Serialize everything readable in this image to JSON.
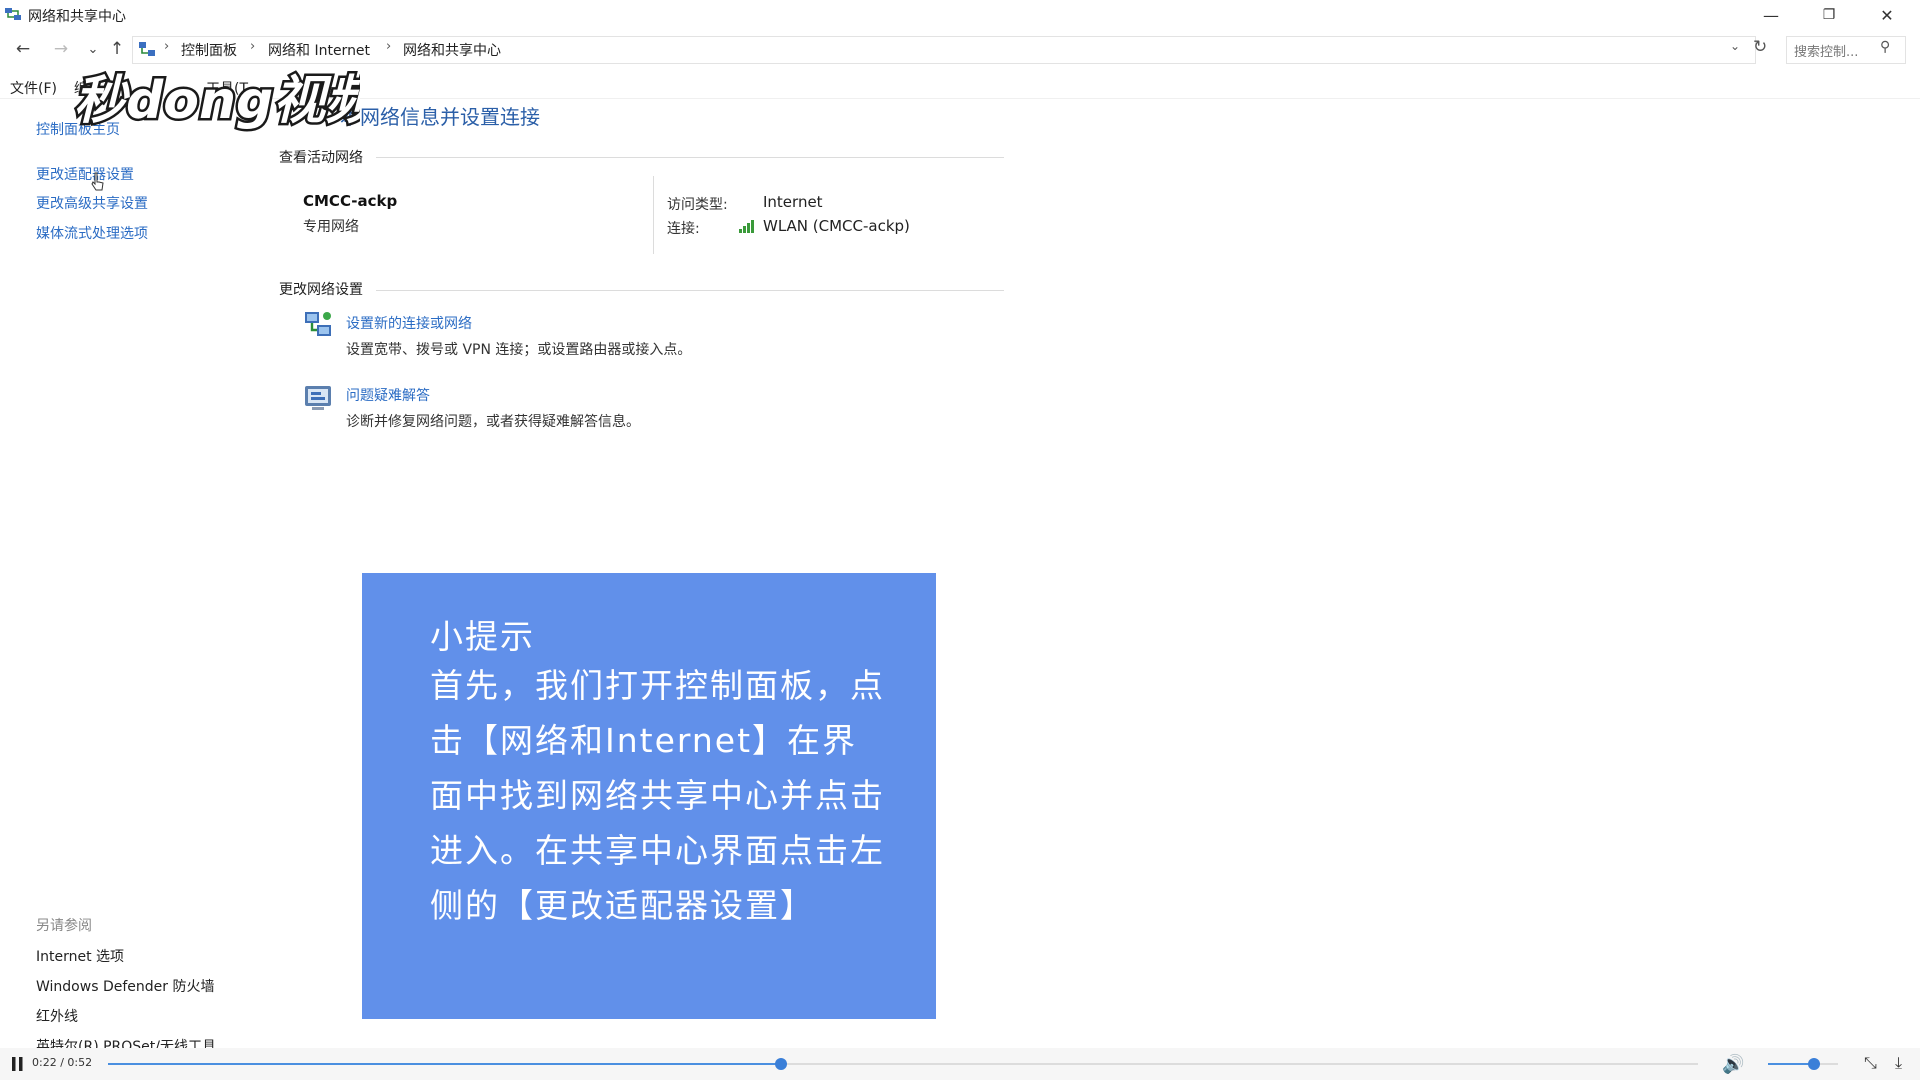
{
  "window": {
    "title": "网络和共享中心",
    "minimize": "—",
    "restore": "❐",
    "close": "✕"
  },
  "address_bar": {
    "back": "←",
    "forward": "→",
    "history": "⌄",
    "up": "↑",
    "breadcrumb": [
      "控制面板",
      "网络和 Internet",
      "网络和共享中心"
    ],
    "separator": "›",
    "dropdown": "⌄",
    "refresh": "↻",
    "search_placeholder": "搜索控制...",
    "search_icon": "⚲"
  },
  "menu": {
    "file": "文件(F)",
    "edit": "编",
    "tools": "工具(T"
  },
  "watermark": {
    "text": "秒dong视频"
  },
  "sidebar": {
    "home": "控制面板主页",
    "items": [
      "更改适配器设置",
      "更改高级共享设置",
      "媒体流式处理选项"
    ],
    "see_also_title": "另请参阅",
    "see_also": [
      "Internet 选项",
      "Windows Defender 防火墙",
      "红外线",
      "英特尔(R) PROSet/无线工具"
    ]
  },
  "main": {
    "title": "本网络信息并设置连接",
    "active_network_heading": "查看活动网络",
    "network_name": "CMCC-ackp",
    "network_type": "专用网络",
    "access_type_label": "访问类型:",
    "access_type_value": "Internet",
    "connection_label": "连接:",
    "connection_value": "WLAN (CMCC-ackp)",
    "change_settings_heading": "更改网络设置",
    "tasks": [
      {
        "link": "设置新的连接或网络",
        "desc": "设置宽带、拨号或 VPN 连接；或设置路由器或接入点。"
      },
      {
        "link": "问题疑难解答",
        "desc": "诊断并修复网络问题，或者获得疑难解答信息。"
      }
    ]
  },
  "tip": {
    "title": "小提示",
    "body": "首先，我们打开控制面板，点击【网络和Internet】在界面中找到网络共享中心并点击进入。在共享中心界面点击左侧的【更改适配器设置】"
  },
  "video": {
    "time": "0:22 / 0:52",
    "progress": 0.423,
    "volume": 0.65
  },
  "colors": {
    "link": "#2b6cc4",
    "tip_background": "#6190ea",
    "progress": "#3a7fd8"
  }
}
